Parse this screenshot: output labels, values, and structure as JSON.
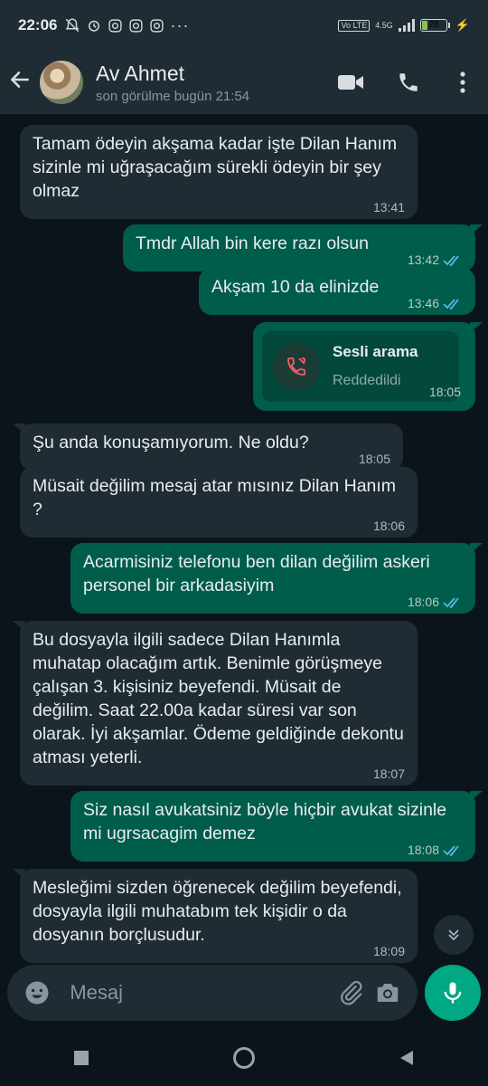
{
  "status_bar": {
    "time": "22:06",
    "network": "4.5G",
    "volte": "Vo LTE",
    "battery": "28"
  },
  "header": {
    "contact_name": "Av Ahmet",
    "last_seen": "son görülme bugün 21:54"
  },
  "messages": [
    {
      "direction": "in",
      "text": "Tamam ödeyin akşama kadar işte Dilan Hanım sizinle mi uğraşacağım sürekli ödeyin bir şey olmaz",
      "time": "13:41"
    },
    {
      "direction": "out",
      "text": "Tmdr Allah bin kere razı olsun",
      "time": "13:42",
      "read": true
    },
    {
      "direction": "out",
      "text": "Akşam 10 da elinizde",
      "time": "13:46",
      "read": true
    },
    {
      "direction": "out",
      "type": "call",
      "title": "Sesli arama",
      "subtitle": "Reddedildi",
      "time": "18:05"
    },
    {
      "direction": "in",
      "text": "Şu anda konuşamıyorum. Ne oldu?",
      "time": "18:05"
    },
    {
      "direction": "in",
      "text": "Müsait değilim mesaj atar mısınız Dilan Hanım ?",
      "time": "18:06"
    },
    {
      "direction": "out",
      "text": "Acarmisiniz telefonu ben dilan değilim askeri personel bir arkadasiyim",
      "time": "18:06",
      "read": true
    },
    {
      "direction": "in",
      "text": "Bu dosyayla ilgili sadece Dilan Hanımla muhatap olacağım artık. Benimle görüşmeye çalışan 3. kişisiniz beyefendi. Müsait de değilim. Saat 22.00a kadar süresi var son olarak. İyi akşamlar. Ödeme geldiğinde dekontu atması yeterli.",
      "time": "18:07"
    },
    {
      "direction": "out",
      "text": "Siz nasıl avukatsiniz böyle hiçbir avukat sizinle mi ugrsacagim demez",
      "time": "18:08",
      "read": true
    },
    {
      "direction": "in",
      "text": "Mesleğimi sizden öğrenecek değilim beyefendi, dosyayla ilgili muhatabım tek kişidir o da dosyanın borçlusudur.",
      "time": "18:09"
    }
  ],
  "composer": {
    "placeholder": "Mesaj"
  },
  "colors": {
    "background": "#0b141a",
    "bar": "#1f2c34",
    "incoming": "#202c33",
    "outgoing": "#005c4b",
    "accent": "#00a884",
    "read_ticks": "#53bdeb"
  }
}
